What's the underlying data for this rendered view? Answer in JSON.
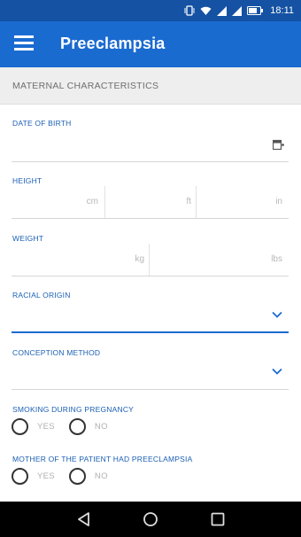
{
  "status_bar": {
    "time": "18:11"
  },
  "app_bar": {
    "title": "Preeclampsia",
    "menu_icon": "hamburger-menu-icon"
  },
  "section": {
    "title": "MATERNAL CHARACTERISTICS"
  },
  "fields": {
    "date_of_birth": {
      "label": "DATE OF BIRTH",
      "icon": "calendar-icon"
    },
    "height": {
      "label": "HEIGHT",
      "units": [
        "cm",
        "ft",
        "in"
      ]
    },
    "weight": {
      "label": "WEIGHT",
      "units": [
        "kg",
        "lbs"
      ]
    },
    "racial_origin": {
      "label": "RACIAL ORIGIN"
    },
    "conception_method": {
      "label": "CONCEPTION METHOD"
    },
    "smoking": {
      "label": "SMOKING DURING PREGNANCY",
      "yes": "YES",
      "no": "NO"
    },
    "mother_preeclampsia": {
      "label": "MOTHER OF THE PATIENT HAD PREECLAMPSIA",
      "yes": "YES",
      "no": "NO"
    }
  },
  "colors": {
    "primary": "#1a6bd0",
    "status": "#1552a3",
    "label": "#1a5fb4"
  }
}
